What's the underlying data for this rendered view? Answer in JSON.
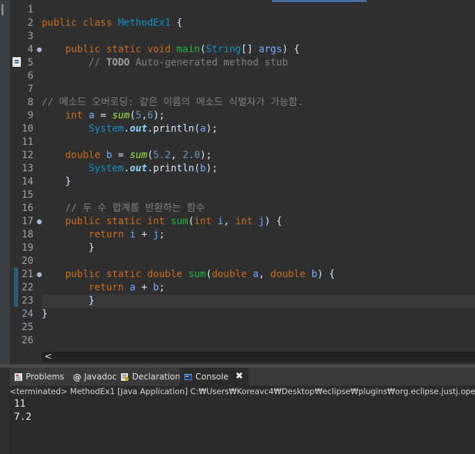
{
  "editor": {
    "line_numbers": [
      "1",
      "2",
      "3",
      "4",
      "5",
      "6",
      "7",
      "8",
      "9",
      "10",
      "11",
      "12",
      "13",
      "14",
      "15",
      "16",
      "17",
      "18",
      "19",
      "20",
      "21",
      "22",
      "23",
      "24",
      "25",
      "26"
    ],
    "lines": [
      [],
      [
        [
          "kw",
          "public class "
        ],
        [
          "type",
          "MethodEx1"
        ],
        [
          "plain",
          " {"
        ]
      ],
      [],
      [
        [
          "kw",
          "    public static void "
        ],
        [
          "mname",
          "main"
        ],
        [
          "plain",
          "("
        ],
        [
          "type",
          "String"
        ],
        [
          "plain",
          "[] "
        ],
        [
          "var",
          "args"
        ],
        [
          "plain",
          ") {"
        ]
      ],
      [
        [
          "cmt",
          "        // "
        ],
        [
          "todo",
          "TODO"
        ],
        [
          "cmt",
          " Auto-generated method stub"
        ]
      ],
      [],
      [],
      [
        [
          "cmt",
          "// 메소드 오버로딩: 같은 이름의 메소드 식별자가 가능함."
        ]
      ],
      [
        [
          "kw",
          "    int "
        ],
        [
          "var",
          "a"
        ],
        [
          "plain",
          " = "
        ],
        [
          "static-m",
          "sum"
        ],
        [
          "plain",
          "("
        ],
        [
          "num",
          "5"
        ],
        [
          "plain",
          ","
        ],
        [
          "num",
          "6"
        ],
        [
          "plain",
          ");"
        ]
      ],
      [
        [
          "plain",
          "        "
        ],
        [
          "type",
          "System"
        ],
        [
          "plain",
          "."
        ],
        [
          "field",
          "out"
        ],
        [
          "plain",
          ".println("
        ],
        [
          "var",
          "a"
        ],
        [
          "plain",
          ");"
        ]
      ],
      [],
      [
        [
          "kw",
          "    double "
        ],
        [
          "var",
          "b"
        ],
        [
          "plain",
          " = "
        ],
        [
          "static-m",
          "sum"
        ],
        [
          "plain",
          "("
        ],
        [
          "num",
          "5.2"
        ],
        [
          "plain",
          ", "
        ],
        [
          "num",
          "2.0"
        ],
        [
          "plain",
          ");"
        ]
      ],
      [
        [
          "plain",
          "        "
        ],
        [
          "type",
          "System"
        ],
        [
          "plain",
          "."
        ],
        [
          "field",
          "out"
        ],
        [
          "plain",
          ".println("
        ],
        [
          "var",
          "b"
        ],
        [
          "plain",
          ");"
        ]
      ],
      [
        [
          "plain",
          "    }"
        ]
      ],
      [],
      [
        [
          "cmt",
          "    // 두 수 합계를 반환하는 함수"
        ]
      ],
      [
        [
          "kw",
          "    public static int "
        ],
        [
          "mname",
          "sum"
        ],
        [
          "plain",
          "("
        ],
        [
          "kw",
          "int "
        ],
        [
          "var",
          "i"
        ],
        [
          "plain",
          ", "
        ],
        [
          "kw",
          "int "
        ],
        [
          "var",
          "j"
        ],
        [
          "plain",
          ") {"
        ]
      ],
      [
        [
          "kw",
          "        return "
        ],
        [
          "var",
          "i"
        ],
        [
          "plain",
          " + "
        ],
        [
          "var",
          "j"
        ],
        [
          "plain",
          ";"
        ]
      ],
      [
        [
          "plain",
          "        }"
        ]
      ],
      [],
      [
        [
          "kw",
          "    public static double "
        ],
        [
          "mname",
          "sum"
        ],
        [
          "plain",
          "("
        ],
        [
          "kw",
          "double "
        ],
        [
          "var",
          "a"
        ],
        [
          "plain",
          ", "
        ],
        [
          "kw",
          "double "
        ],
        [
          "var",
          "b"
        ],
        [
          "plain",
          ") {"
        ]
      ],
      [
        [
          "kw",
          "        return "
        ],
        [
          "var",
          "a"
        ],
        [
          "plain",
          " + "
        ],
        [
          "var",
          "b"
        ],
        [
          "plain",
          ";"
        ]
      ],
      [
        [
          "plain",
          "        }"
        ]
      ],
      [
        [
          "plain",
          "}"
        ]
      ],
      [],
      []
    ],
    "scroll_left_arrow": "<"
  },
  "tabs": [
    {
      "label": "Problems",
      "icon": "problems-icon"
    },
    {
      "label": "Javadoc",
      "icon": "javadoc-icon"
    },
    {
      "label": "Declaration",
      "icon": "declaration-icon"
    },
    {
      "label": "Console",
      "icon": "console-icon",
      "close": "✖"
    }
  ],
  "console": {
    "status": "<terminated> MethodEx1 [Java Application] C:₩Users₩Koreavc4₩Desktop₩eclipse₩plugins₩org.eclipse.justj.openjdk.hotspot",
    "output": [
      "11",
      "7.2"
    ]
  }
}
